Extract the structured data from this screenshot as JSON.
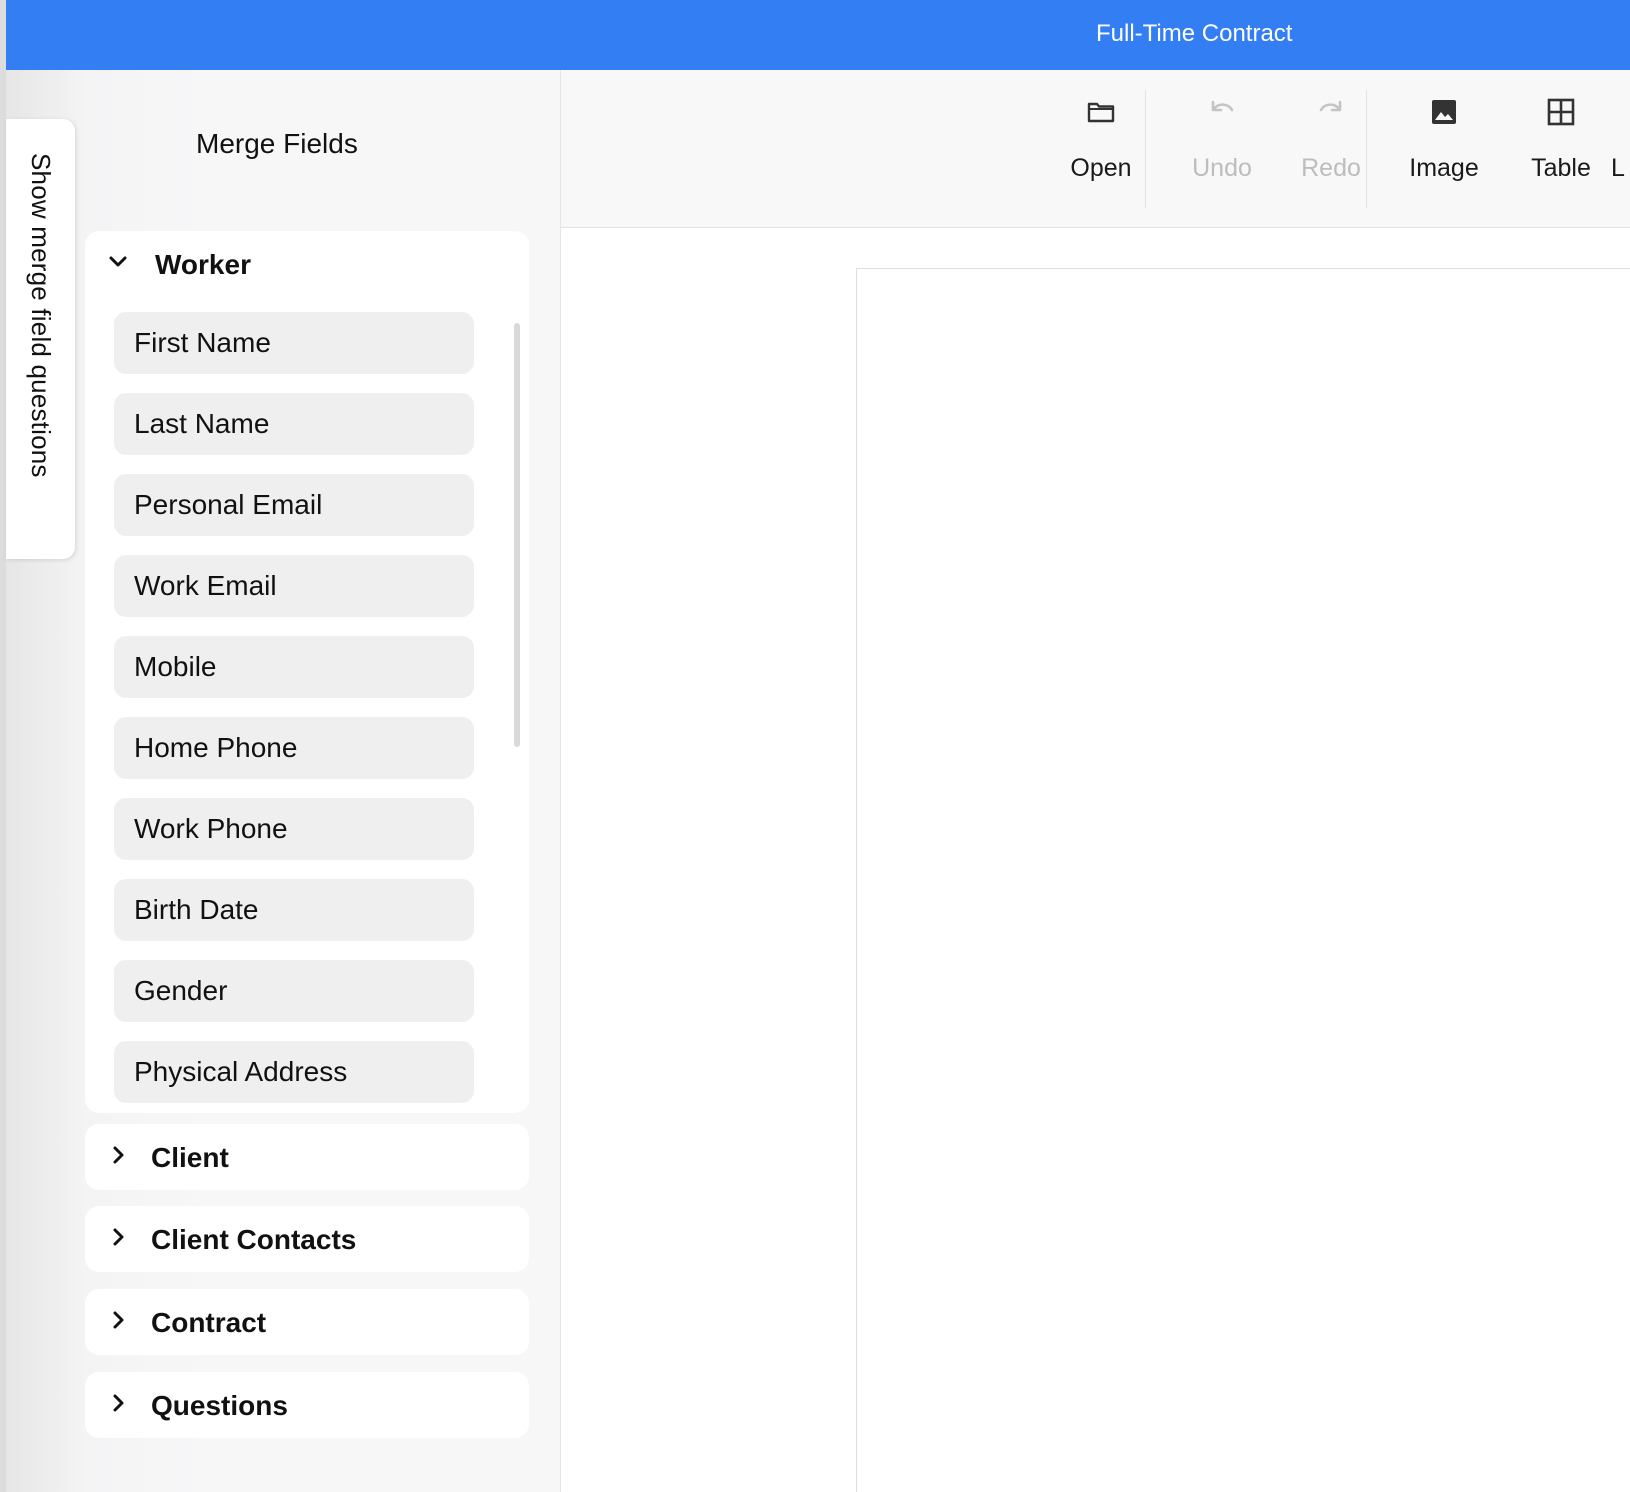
{
  "window": {
    "title": "Full-Time Contract"
  },
  "sidebar": {
    "tab_label": "Show merge field questions",
    "title": "Merge Fields",
    "groups": [
      {
        "label": "Worker",
        "expanded": true,
        "fields": [
          "First Name",
          "Last Name",
          "Personal Email",
          "Work Email",
          "Mobile",
          "Home Phone",
          "Work Phone",
          "Birth Date",
          "Gender",
          "Physical Address"
        ]
      },
      {
        "label": "Client",
        "expanded": false
      },
      {
        "label": "Client Contacts",
        "expanded": false
      },
      {
        "label": "Contract",
        "expanded": false
      },
      {
        "label": "Questions",
        "expanded": false
      }
    ]
  },
  "toolbar": {
    "items": [
      {
        "label": "Open",
        "icon": "folder-icon",
        "enabled": true
      },
      {
        "label": "Undo",
        "icon": "undo-icon",
        "enabled": false
      },
      {
        "label": "Redo",
        "icon": "redo-icon",
        "enabled": false
      },
      {
        "label": "Image",
        "icon": "image-icon",
        "enabled": true
      },
      {
        "label": "Table",
        "icon": "table-icon",
        "enabled": true
      },
      {
        "label": "L",
        "icon": "",
        "enabled": true
      }
    ]
  },
  "colors": {
    "title_bar": "#337ef3",
    "enabled_text": "#1a1a1a",
    "disabled_text": "#bdbdbd",
    "pill_bg": "#efefef"
  }
}
